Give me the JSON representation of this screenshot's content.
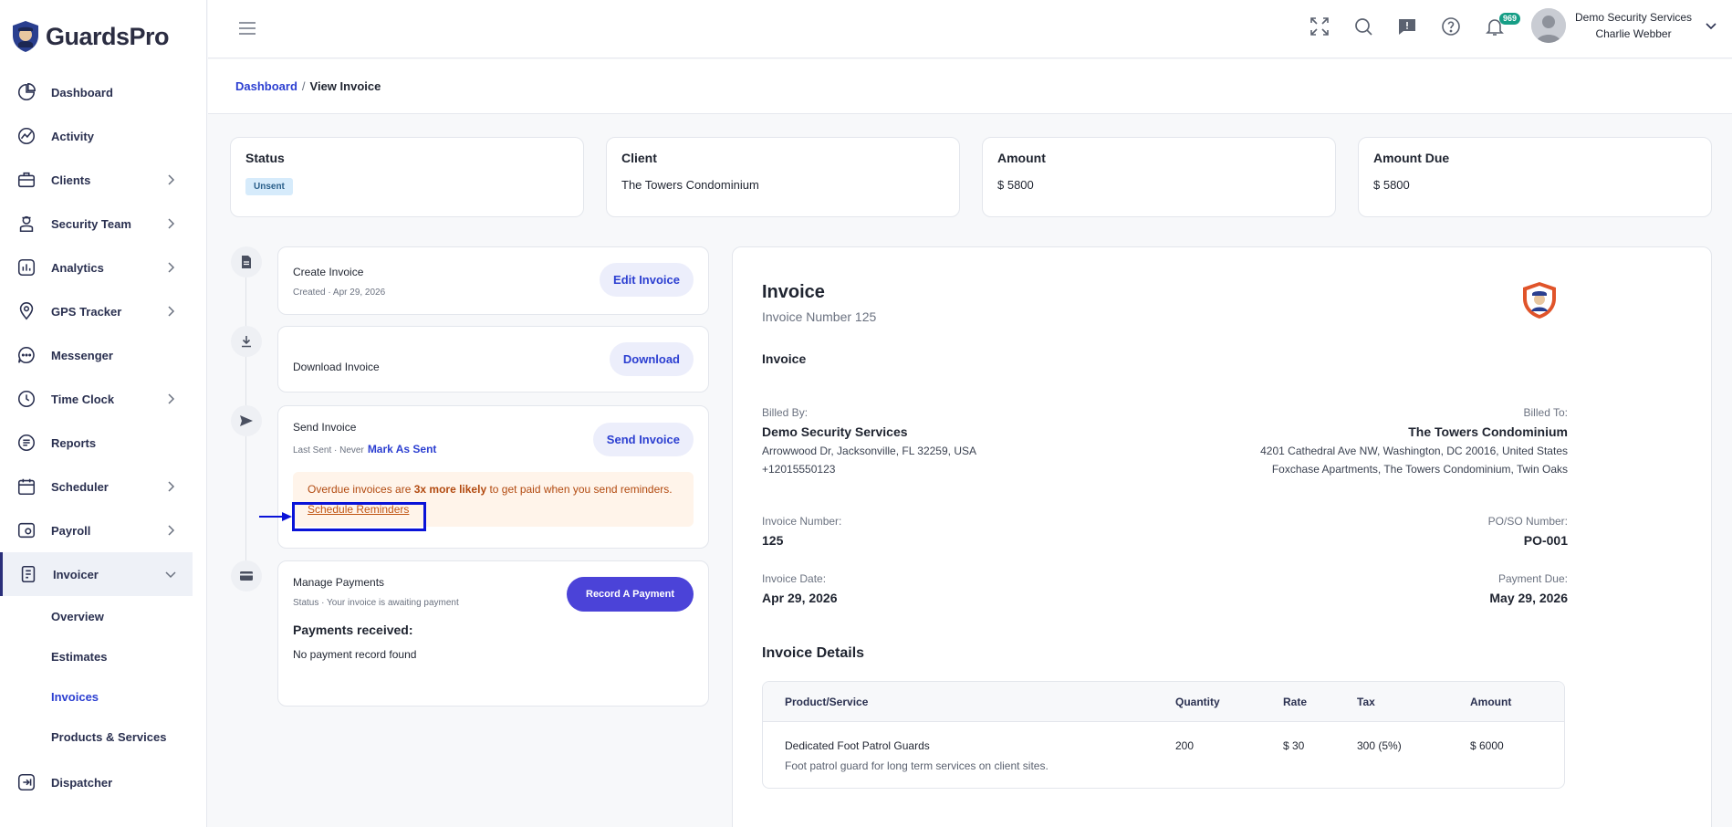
{
  "app": {
    "name": "GuardsPro"
  },
  "sidebar": {
    "items": [
      {
        "label": "Dashboard",
        "icon": "dashboard-icon",
        "chevron": false
      },
      {
        "label": "Activity",
        "icon": "activity-icon",
        "chevron": false
      },
      {
        "label": "Clients",
        "icon": "clients-icon",
        "chevron": true
      },
      {
        "label": "Security Team",
        "icon": "security-team-icon",
        "chevron": true
      },
      {
        "label": "Analytics",
        "icon": "analytics-icon",
        "chevron": true
      },
      {
        "label": "GPS Tracker",
        "icon": "gps-icon",
        "chevron": true
      },
      {
        "label": "Messenger",
        "icon": "messenger-icon",
        "chevron": false
      },
      {
        "label": "Time Clock",
        "icon": "clock-icon",
        "chevron": true
      },
      {
        "label": "Reports",
        "icon": "reports-icon",
        "chevron": false
      },
      {
        "label": "Scheduler",
        "icon": "calendar-icon",
        "chevron": true
      },
      {
        "label": "Payroll",
        "icon": "payroll-icon",
        "chevron": true
      },
      {
        "label": "Invoicer",
        "icon": "invoicer-icon",
        "chevron": true,
        "expanded": true
      }
    ],
    "subitems": [
      {
        "label": "Overview"
      },
      {
        "label": "Estimates"
      },
      {
        "label": "Invoices",
        "current": true
      },
      {
        "label": "Products & Services"
      }
    ],
    "after": {
      "label": "Dispatcher",
      "icon": "dispatcher-icon"
    }
  },
  "topbar": {
    "notification_count": "969",
    "company": "Demo Security Services",
    "user": "Charlie Webber"
  },
  "breadcrumb": {
    "root": "Dashboard",
    "separator": "/",
    "current": "View Invoice"
  },
  "stats": {
    "status_label": "Status",
    "status_value": "Unsent",
    "client_label": "Client",
    "client_value": "The Towers Condominium",
    "amount_label": "Amount",
    "amount_value": "$ 5800",
    "due_label": "Amount Due",
    "due_value": "$ 5800"
  },
  "timeline": {
    "create": {
      "title": "Create Invoice",
      "sub": "Created · Apr 29, 2026",
      "button": "Edit Invoice"
    },
    "download": {
      "title": "Download Invoice",
      "button": "Download"
    },
    "send": {
      "title": "Send Invoice",
      "sub": "Last Sent · Never",
      "mark_as_sent": "Mark As Sent",
      "button": "Send Invoice",
      "alert_pre": "Overdue invoices are ",
      "alert_bold": "3x more likely",
      "alert_post": " to get paid when you send reminders.",
      "schedule_link": "Schedule Reminders"
    },
    "payments": {
      "title": "Manage Payments",
      "sub": "Status · Your invoice is awaiting payment",
      "button": "Record A Payment",
      "received_title": "Payments received:",
      "received_none": "No payment record found"
    }
  },
  "invoice": {
    "title": "Invoice",
    "number_line": "Invoice Number 125",
    "subtitle": "Invoice",
    "billed_by_label": "Billed By:",
    "billed_by_name": "Demo Security Services",
    "billed_by_addr": "Arrowwood Dr, Jacksonville, FL 32259, USA",
    "billed_by_phone": "+12015550123",
    "billed_to_label": "Billed To:",
    "billed_to_name": "The Towers Condominium",
    "billed_to_addr": "4201 Cathedral Ave NW, Washington, DC 20016, United States",
    "billed_to_addr2": "Foxchase Apartments, The Towers Condominium, Twin Oaks",
    "invoice_number_label": "Invoice Number:",
    "invoice_number": "125",
    "po_label": "PO/SO Number:",
    "po": "PO-001",
    "date_label": "Invoice Date:",
    "date": "Apr 29, 2026",
    "due_label": "Payment Due:",
    "due": "May 29, 2026",
    "details_title": "Invoice Details",
    "columns": [
      "Product/Service",
      "Quantity",
      "Rate",
      "Tax",
      "Amount"
    ],
    "rows": [
      {
        "product": "Dedicated Foot Patrol Guards",
        "description": "Foot patrol guard for long term services on client sites.",
        "quantity": "200",
        "rate": "$ 30",
        "tax": "300 (5%)",
        "amount": "$ 6000"
      }
    ]
  },
  "colors": {
    "accent": "#2c3fd1",
    "button": "#4b43d8",
    "highlight": "#0a13d8",
    "alert": "#b24a10"
  }
}
